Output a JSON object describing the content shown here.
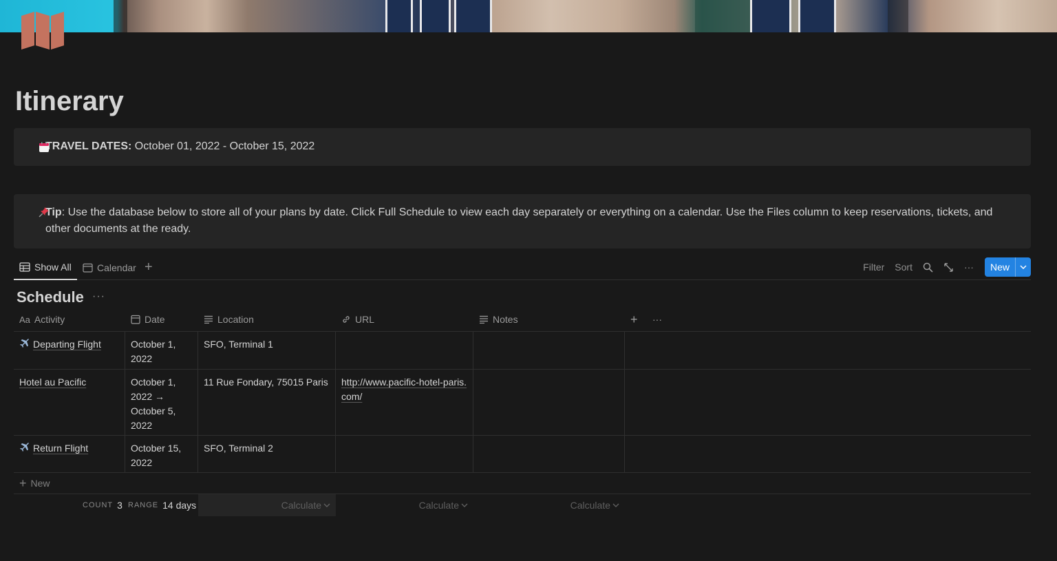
{
  "page": {
    "title": "Itinerary"
  },
  "callouts": {
    "dates": {
      "label": "TRAVEL DATES:",
      "value": " October 01, 2022 - October 15, 2022"
    },
    "tip": {
      "label": "Tip",
      "text": ": Use the database below to store all of your plans by date. Click Full Schedule to view each day separately or everything on a calendar. Use the Files column to keep reservations, tickets, and other documents at the ready."
    }
  },
  "views": {
    "tabs": [
      {
        "label": "Show All",
        "active": true
      },
      {
        "label": "Calendar",
        "active": false
      }
    ],
    "add_symbol": "+"
  },
  "toolbar": {
    "filter": "Filter",
    "sort": "Sort",
    "more": "···",
    "new_label": "New"
  },
  "database": {
    "title": "Schedule",
    "more": "···",
    "columns": {
      "activity": "Activity",
      "activity_prefix": "Aa",
      "date": "Date",
      "location": "Location",
      "url": "URL",
      "notes": "Notes",
      "add": "+",
      "more": "···"
    },
    "rows": [
      {
        "activity": "Departing Flight",
        "date": "October 1, 2022",
        "location": "SFO, Terminal 1",
        "url": "",
        "notes": ""
      },
      {
        "activity": "Hotel au Pacific",
        "date": "October 1, 2022 → October 5, 2022",
        "location": "11 Rue Fondary, 75015 Paris",
        "url": "http://www.pacific-hotel-paris.com/",
        "notes": ""
      },
      {
        "activity": "Return Flight",
        "date": "October 15, 2022",
        "location": "SFO, Terminal 2",
        "url": "",
        "notes": ""
      }
    ],
    "new_row": "New",
    "footer": {
      "count_label": "COUNT",
      "count_value": "3",
      "range_label": "RANGE",
      "range_value": "14 days",
      "calculate_1": "Calculate",
      "calculate_2": "Calculate",
      "calculate_3": "Calculate"
    }
  },
  "colors": {
    "background": "#191919",
    "callout": "#252525",
    "accent": "#2383e2",
    "page_icon": "#c4735f"
  },
  "icons": {
    "page_icon": "map-icon",
    "dates": "calendar-icon",
    "tip": "pushpin-icon",
    "activity_row": "airplane-icon"
  }
}
